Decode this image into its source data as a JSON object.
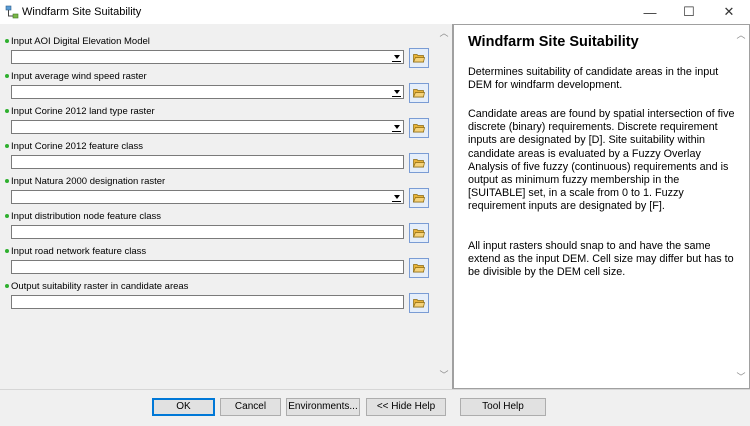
{
  "window": {
    "title": "Windfarm Site Suitability",
    "controls": {
      "minimize": "—",
      "maximize": "☐",
      "close": "✕"
    }
  },
  "form": {
    "fields": [
      {
        "label": "Input AOI Digital Elevation Model",
        "value": "",
        "type": "dropdown"
      },
      {
        "label": "Input average wind speed raster",
        "value": "",
        "type": "dropdown"
      },
      {
        "label": "Input Corine 2012 land type raster",
        "value": "",
        "type": "dropdown"
      },
      {
        "label": "Input Corine 2012 feature class",
        "value": "",
        "type": "text"
      },
      {
        "label": "Input Natura 2000 designation raster",
        "value": "",
        "type": "dropdown"
      },
      {
        "label": "Input distribution node feature class",
        "value": "",
        "type": "text"
      },
      {
        "label": "Input road network feature class",
        "value": "",
        "type": "text"
      },
      {
        "label": "Output suitability raster in candidate areas",
        "value": "",
        "type": "text"
      }
    ]
  },
  "help": {
    "title": "Windfarm Site Suitability",
    "p1": "Determines suitability of candidate areas in the input DEM for windfarm development.",
    "p2": "Candidate areas are found by spatial intersection of five discrete (binary) requirements. Discrete requirement inputs are designated by [D]. Site suitability within candidate areas is evaluated by a Fuzzy Overlay Analysis of five fuzzy (continuous) requirements and is output as minimum fuzzy membership in the [SUITABLE] set, in a scale from 0 to 1. Fuzzy requirement inputs are designated by [F].",
    "p3": "All input rasters should snap to and have the same extend as the input DEM. Cell size may differ but has to be divisible by the DEM cell size."
  },
  "buttons": {
    "ok": "OK",
    "cancel": "Cancel",
    "environments": "Environments...",
    "hide_help": "<< Hide Help",
    "tool_help": "Tool Help"
  },
  "colors": {
    "required_dot": "#2fb02f",
    "default_button_border": "#0078d7",
    "browse_folder": "#e8b33a"
  },
  "icons": {
    "app": "tool-icon",
    "browse": "open-folder-icon"
  }
}
